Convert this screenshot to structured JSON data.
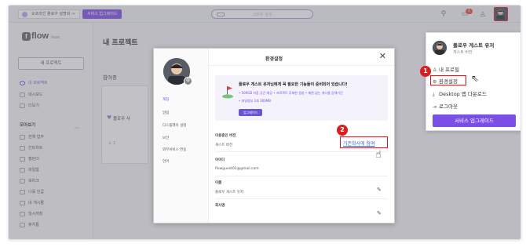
{
  "topbar": {
    "guide_btn": "오프라인 플로우 설명회 →",
    "upgrade_pill": "서비스 업그레이드",
    "search_placeholder": "스마트 검색",
    "alert_count": "1"
  },
  "sidebar": {
    "logo": "flow",
    "logo_sub": "team",
    "new_project": "새 프로젝트",
    "nav": [
      "내 프로젝트",
      "대시보드",
      "더보기"
    ],
    "section_label": "모아보기",
    "collect": [
      "전체 업무",
      "간트차트",
      "캘린더",
      "파일함",
      "북마크",
      "나를 언급",
      "내 게시물",
      "임시저장",
      "휴지통"
    ]
  },
  "main": {
    "page_title": "내 프로젝트",
    "section": "참여중",
    "card_title": "플로우 사",
    "card_people": "1"
  },
  "modal": {
    "title": "환경설정",
    "side_items": [
      "계정",
      "알림",
      "디스플레이 설정",
      "보안",
      "외부서비스 연동",
      "언어"
    ],
    "promo_title": "플로우 게스트 유저님에게 꼭 필요한 기능들이 준비되어 있습니다!",
    "promo_features_line1": "• 500GB 저장 공간 제공   • 프로젝트 무제한 생성   • 제한 없는 게시물 검색기간",
    "promo_features_line2": "• 파일첨부 1회 300MB",
    "promo_button": "업그레이드",
    "fields": [
      {
        "label": "이용중인 버전",
        "value": "게스트 버전"
      },
      {
        "label": "아이디",
        "value": "flowguest01@gmail.com"
      },
      {
        "label": "이름",
        "value": "플로우 게스트 유저"
      },
      {
        "label": "회사명",
        "value": ""
      }
    ],
    "join_link": "기존회사에 참여",
    "step2": "2"
  },
  "dropdown": {
    "name": "플로우 게스트 유저",
    "subtitle": "게스트 버전",
    "items": [
      "내 프로필",
      "환경설정",
      "Desktop 앱 다운로드",
      "로그아웃"
    ],
    "upgrade_btn": "서비스 업그레이드",
    "step1": "1"
  },
  "colors": {
    "accent": "#7b4ee6",
    "highlight": "#e3131b",
    "link": "#3d6fd6"
  }
}
